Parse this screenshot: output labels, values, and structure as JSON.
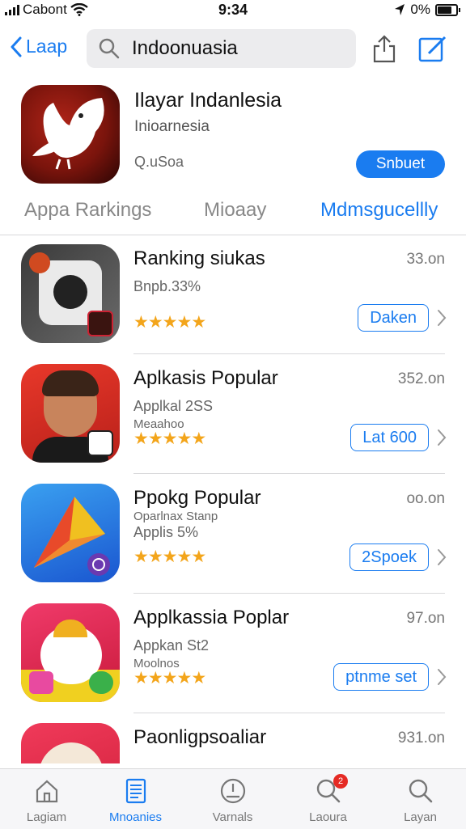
{
  "status_bar": {
    "carrier": "Cabont",
    "time": "9:34",
    "battery": "0%"
  },
  "nav": {
    "back_label": "Laap",
    "search_value": "Indoonuasia"
  },
  "featured": {
    "title": "Ilayar Indanlesia",
    "subtitle": "Inioarnesia",
    "meta": "Q.uSoa",
    "button": "Snbuet"
  },
  "tabs": [
    {
      "label": "Appa Rarkings"
    },
    {
      "label": "Mioaay"
    },
    {
      "label": "Mdmsgucellly"
    }
  ],
  "apps": [
    {
      "title": "Ranking siukas",
      "subtitle": "Bnpb.33%",
      "line2": "",
      "rating": 4.5,
      "size": "33.on",
      "button": "Daken"
    },
    {
      "title": "Aplkasis Popular",
      "subtitle": "Applkal 2SS",
      "line2": "Meaahoo",
      "rating": 4.5,
      "size": "352.on",
      "button": "Lat 600"
    },
    {
      "title": "Ppokg Popular",
      "subtitle": "Applis 5%",
      "line2": "Oparlnax Stanp",
      "rating": 4.5,
      "size": "oo.on",
      "button": "2Spoek"
    },
    {
      "title": "Applkassia Poplar",
      "subtitle": "Appkan St2",
      "line2": "Moolnos",
      "rating": 5,
      "size": "97.on",
      "button": "ptnme set"
    },
    {
      "title": "Paonligpsoaliar",
      "subtitle": "",
      "line2": "",
      "rating": 0,
      "size": "931.on",
      "button": ""
    }
  ],
  "tab_bar": [
    {
      "label": "Lagiam",
      "icon": "home-icon"
    },
    {
      "label": "Mnoanies",
      "icon": "document-icon"
    },
    {
      "label": "Varnals",
      "icon": "clock-icon"
    },
    {
      "label": "Laoura",
      "icon": "search-icon",
      "badge": "2"
    },
    {
      "label": "Layan",
      "icon": "search-icon"
    }
  ],
  "colors": {
    "accent": "#1a7cf0",
    "star": "#f3a51b",
    "badge": "#e52a24"
  }
}
